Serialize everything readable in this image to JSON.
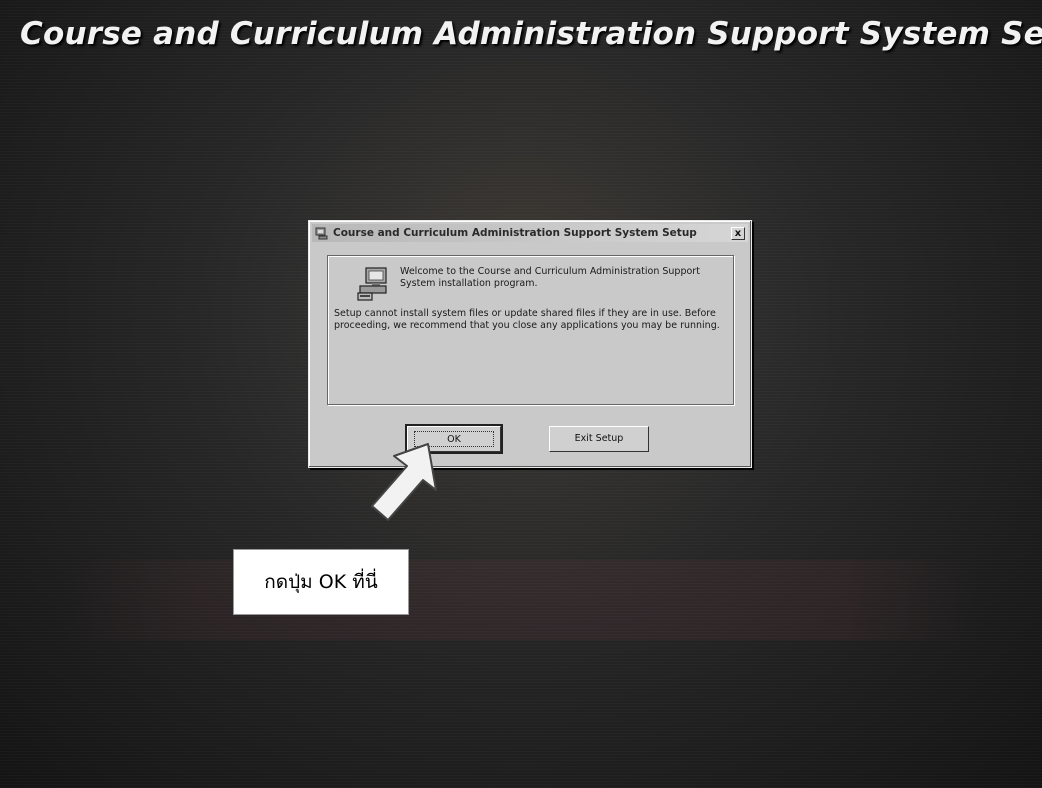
{
  "header": {
    "title": "Course and Curriculum Administration Support System Setup"
  },
  "dialog": {
    "title": "Course and Curriculum Administration Support System Setup",
    "close_label": "x",
    "welcome_text": "Welcome to the Course and Curriculum Administration Support System installation program.",
    "warning_text": "Setup cannot install system files or update shared files if they are in use. Before proceeding, we recommend that you close any applications you may be running.",
    "ok_label": "OK",
    "exit_label": "Exit Setup"
  },
  "annotation": {
    "callout_text": "กดปุ่ม OK ที่นี่"
  },
  "icons": {
    "app": "setup-app-icon",
    "installer": "computer-setup-icon",
    "arrow": "pointer-arrow"
  },
  "colors": {
    "background": "#1a1a1a",
    "dialog": "#c9c9c9",
    "callout": "#ffffff"
  }
}
